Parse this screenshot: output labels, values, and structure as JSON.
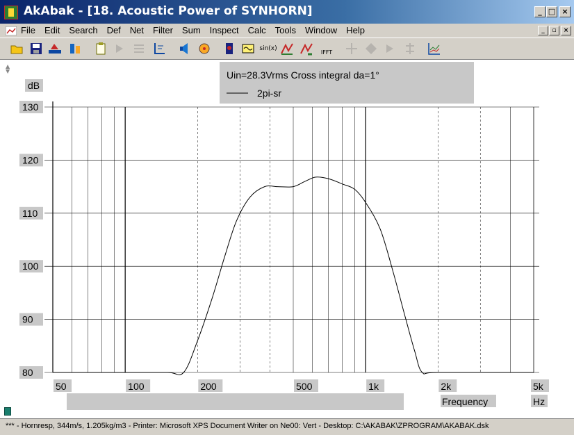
{
  "window": {
    "title": "AkAbak - [18. Acoustic Power of SYNHORN]",
    "minimize": "_",
    "maximize": "□",
    "close": "×"
  },
  "menu": {
    "items": [
      "File",
      "Edit",
      "Search",
      "Def",
      "Net",
      "Filter",
      "Sum",
      "Inspect",
      "Calc",
      "Tools",
      "Window",
      "Help"
    ]
  },
  "mdi": {
    "minimize": "_",
    "restore": "▫",
    "close": "×"
  },
  "toolbar": {
    "sin_label": "sin(x)",
    "ifft_label": "IFFT",
    "buttons": [
      "open-icon",
      "save-icon",
      "network-icon",
      "print-icon",
      "clipboard-icon",
      "arrow-icon",
      "align-icon",
      "axes-icon",
      "speaker-icon",
      "probe-icon",
      "record-icon",
      "filter-icon",
      "sin-icon",
      "plot-icon",
      "plot2-icon",
      "ifft-icon",
      "disabled-1",
      "disabled-2",
      "disabled-3",
      "disabled-4",
      "overlay-icon"
    ]
  },
  "chart_data": {
    "type": "line",
    "title": "Uin=28.3Vrms Cross integral da=1°",
    "ylabel": "dB",
    "xlabel": "Frequency",
    "x_unit": "Hz",
    "xscale": "log",
    "xlim": [
      50,
      5000
    ],
    "ylim": [
      80,
      130
    ],
    "y_ticks": [
      "130",
      "120",
      "110",
      "100",
      "90",
      "80"
    ],
    "x_ticks": [
      "50",
      "100",
      "200",
      "500",
      "1k",
      "2k",
      "5k"
    ],
    "legend": "top-center",
    "grid": true,
    "series": [
      {
        "name": "2pi-sr",
        "points": [
          [
            50,
            80
          ],
          [
            100,
            80
          ],
          [
            150,
            80
          ],
          [
            175,
            80
          ],
          [
            200,
            86
          ],
          [
            230,
            94
          ],
          [
            260,
            102
          ],
          [
            290,
            108.5
          ],
          [
            330,
            113
          ],
          [
            380,
            115
          ],
          [
            430,
            115
          ],
          [
            500,
            115
          ],
          [
            560,
            116
          ],
          [
            620,
            116.8
          ],
          [
            700,
            116.5
          ],
          [
            800,
            115.5
          ],
          [
            900,
            114.5
          ],
          [
            1000,
            112
          ],
          [
            1150,
            107
          ],
          [
            1300,
            99
          ],
          [
            1450,
            91
          ],
          [
            1600,
            84
          ],
          [
            1720,
            80
          ],
          [
            2000,
            80
          ],
          [
            5000,
            80
          ]
        ]
      }
    ]
  },
  "status": {
    "text": "*** - Hornresp, 344m/s, 1.205kg/m3 - Printer: Microsoft XPS Document Writer on Ne00: Vert - Desktop: C:\\AKABAK\\ZPROGRAM\\AKABAK.dsk"
  },
  "colors": {
    "title_start": "#0a246a",
    "title_end": "#a6caf0",
    "chrome": "#d4d0c8",
    "grid": "#000000",
    "label_bg": "#c8c8c8"
  }
}
